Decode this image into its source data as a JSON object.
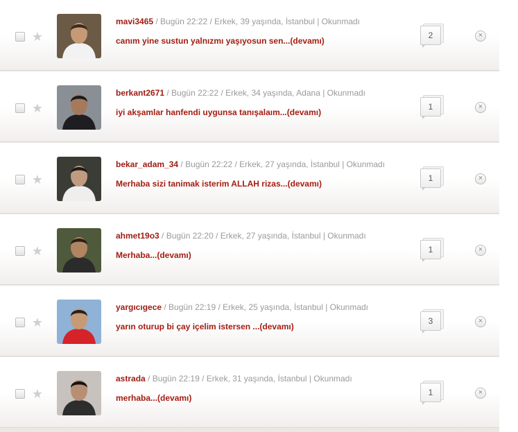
{
  "messages": [
    {
      "username": "mavi3465",
      "meta": " / Bugün 22:22 / Erkek, 39 yaşında, İstanbul | Okunmadı",
      "preview": "canım yine sustun yalnızmı yaşıyosun sen...(devamı)",
      "count": "2",
      "avatar": {
        "bg": "#6b5a45",
        "skin": "#c69a77",
        "shirt": "#f2f2f2",
        "hair": "#3a2a1f"
      }
    },
    {
      "username": "berkant2671",
      "meta": " / Bugün 22:22 / Erkek, 34 yaşında, Adana | Okunmadı",
      "preview": "iyi akşamlar hanfendi uygunsa tanışalaım...(devamı)",
      "count": "1",
      "avatar": {
        "bg": "#8a8f96",
        "skin": "#a6795d",
        "shirt": "#1e1e22",
        "hair": "#1b1b1b"
      }
    },
    {
      "username": "bekar_adam_34",
      "meta": " / Bugün 22:22 / Erkek, 27 yaşında, İstanbul | Okunmadı",
      "preview": "Merhaba sizi tanimak isterim ALLAH rizas...(devamı)",
      "count": "1",
      "avatar": {
        "bg": "#3b3c36",
        "skin": "#c19b80",
        "shirt": "#eeeeee",
        "hair": "#1b1b1b"
      }
    },
    {
      "username": "ahmet19o3",
      "meta": " / Bugün 22:20 / Erkek, 27 yaşında, İstanbul | Okunmadı",
      "preview": "Merhaba...(devamı)",
      "count": "1",
      "avatar": {
        "bg": "#4f5a3c",
        "skin": "#b18561",
        "shirt": "#2b2b2b",
        "hair": "#2a1f17"
      }
    },
    {
      "username": "yargıcıgece",
      "meta": " / Bugün 22:19 / Erkek, 25 yaşında, İstanbul | Okunmadı",
      "preview": "yarın oturup bi çay içelim istersen ...(devamı)",
      "count": "3",
      "avatar": {
        "bg": "#8fb2d6",
        "skin": "#c79a76",
        "shirt": "#d6232a",
        "hair": "#2a1f17"
      }
    },
    {
      "username": "astrada",
      "meta": " / Bugün 22:19 / Erkek, 31 yaşında, İstanbul | Okunmadı",
      "preview": "merhaba...(devamı)",
      "count": "1",
      "avatar": {
        "bg": "#c7c2bd",
        "skin": "#b88f73",
        "shirt": "#2d2d2d",
        "hair": "#141414"
      }
    }
  ],
  "icons": {
    "star": "★",
    "close": "×"
  }
}
